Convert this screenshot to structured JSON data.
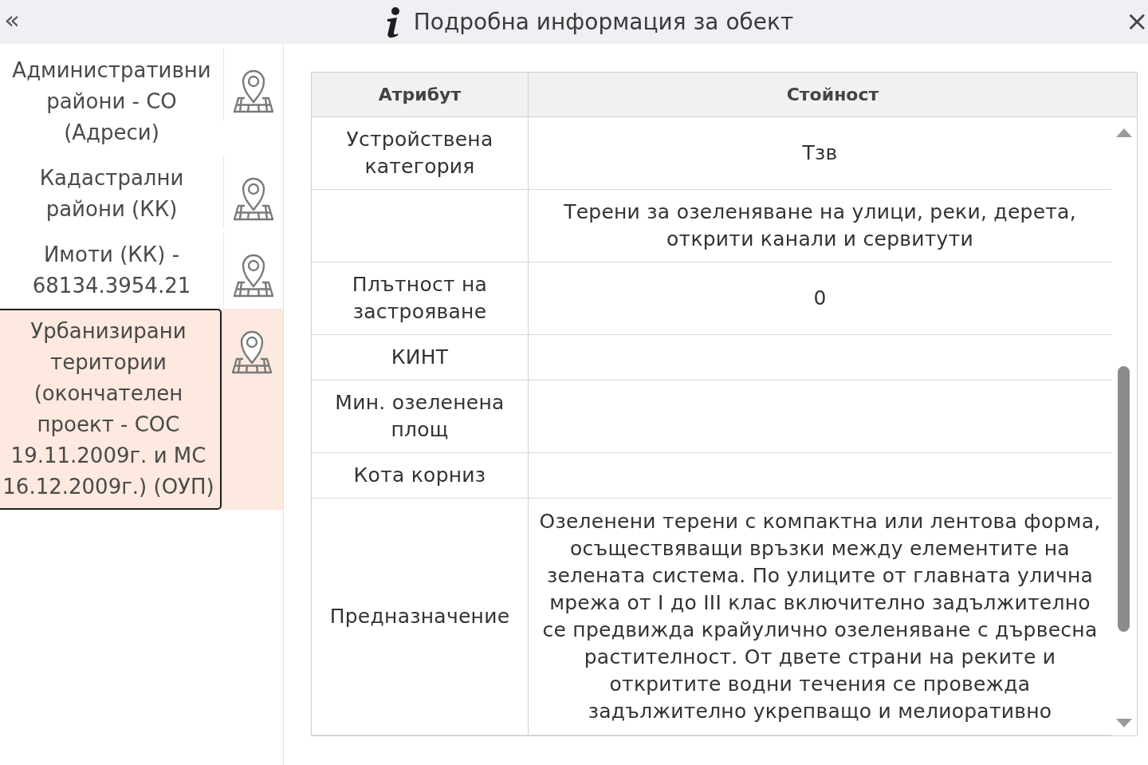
{
  "header": {
    "collapse_glyph": "«",
    "title": "Подробна информация за обект",
    "close_glyph": "×"
  },
  "layers": [
    {
      "name": "Административни райони - СО (Адреси)",
      "selected": false
    },
    {
      "name": "Кадастрални райони (КК)",
      "selected": false
    },
    {
      "name": "Имоти (КК) - 68134.3954.21",
      "selected": false
    },
    {
      "name": "Урбанизирани територии (окончателен проект - СОС 19.11.2009г. и МС 16.12.2009г.) (ОУП)",
      "selected": true
    }
  ],
  "table": {
    "columns": [
      "Атрибут",
      "Стойност"
    ],
    "rows": [
      {
        "attribute": "Устройствена категория",
        "value": "Тзв"
      },
      {
        "value": "Терени за озеленяване на улици, реки, дерета, открити канали и сервитути"
      },
      {
        "attribute": "Плътност на застрояване",
        "value": "0"
      },
      {
        "attribute": "КИНТ"
      },
      {
        "attribute": "Мин. озеленена площ"
      },
      {
        "attribute": "Кота корниз"
      },
      {
        "attribute": "Предназначение",
        "value": "Озеленени терени с компактна или лентова форма, осъществяващи връзки между елементите на зелената система. По улиците от главната улична мрежа от I до III клас включително задължително се предвижда крайулично озеленяване с дървесна растителност. От двете страни на реките и откритите водни течения се провежда задължително укрепващо и мелиоративно"
      }
    ]
  }
}
